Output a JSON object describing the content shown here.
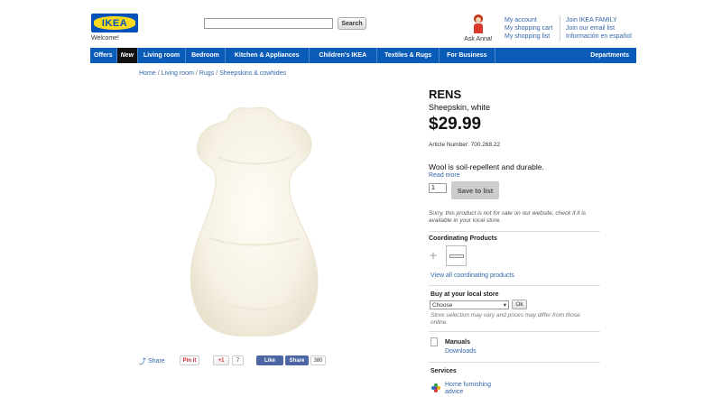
{
  "header": {
    "logo_text": "IKEA",
    "welcome": "Welcome!",
    "search_placeholder": "",
    "search_button": "Search",
    "ask_anna": "Ask Anna!",
    "account_links": [
      "My account",
      "My shopping cart",
      "My shopping list"
    ],
    "family_links": [
      "Join IKEA FAMILY",
      "Join our email list",
      "Información en español"
    ]
  },
  "nav": {
    "items": [
      "Offers",
      "New",
      "Living room",
      "Bedroom",
      "Kitchen & Appliances",
      "Children's IKEA",
      "Textiles & Rugs",
      "For Business"
    ],
    "departments": "Departments"
  },
  "breadcrumb": [
    "Home",
    "Living room",
    "Rugs",
    "Sheepskins & cowhides"
  ],
  "share": {
    "share_label": "Share",
    "pinit": "Pin it",
    "gplus": "+1",
    "gplus_count": "7",
    "fb_like": "Like",
    "fb_share": "Share",
    "fb_count": "380"
  },
  "product": {
    "name": "RENS",
    "description": "Sheepskin, white",
    "price": "$29.99",
    "article_label": "Article Number:",
    "article_number": "700.268.22",
    "tagline": "Wool is soil-repellent and durable.",
    "read_more": "Read more",
    "quantity": "1",
    "save_to_list": "Save to list",
    "notice": "Sorry, this product is not for sale on our website, check if it is available in your local store."
  },
  "coordinating": {
    "title": "Coordinating Products",
    "view_all": "View all coordinating products"
  },
  "buy": {
    "title": "Buy at your local store",
    "select_value": "Choose",
    "ok": "Ok",
    "note": "Store selection may vary and prices may differ from those online."
  },
  "manuals": {
    "title": "Manuals",
    "downloads": "Downloads"
  },
  "services": {
    "title": "Services",
    "home_furnishing": "Home furnishing advice"
  },
  "colors": {
    "ikea_blue": "#0051ba",
    "ikea_yellow": "#ffda1a",
    "nav_blue": "#0b5bb8",
    "link": "#3366aa"
  }
}
